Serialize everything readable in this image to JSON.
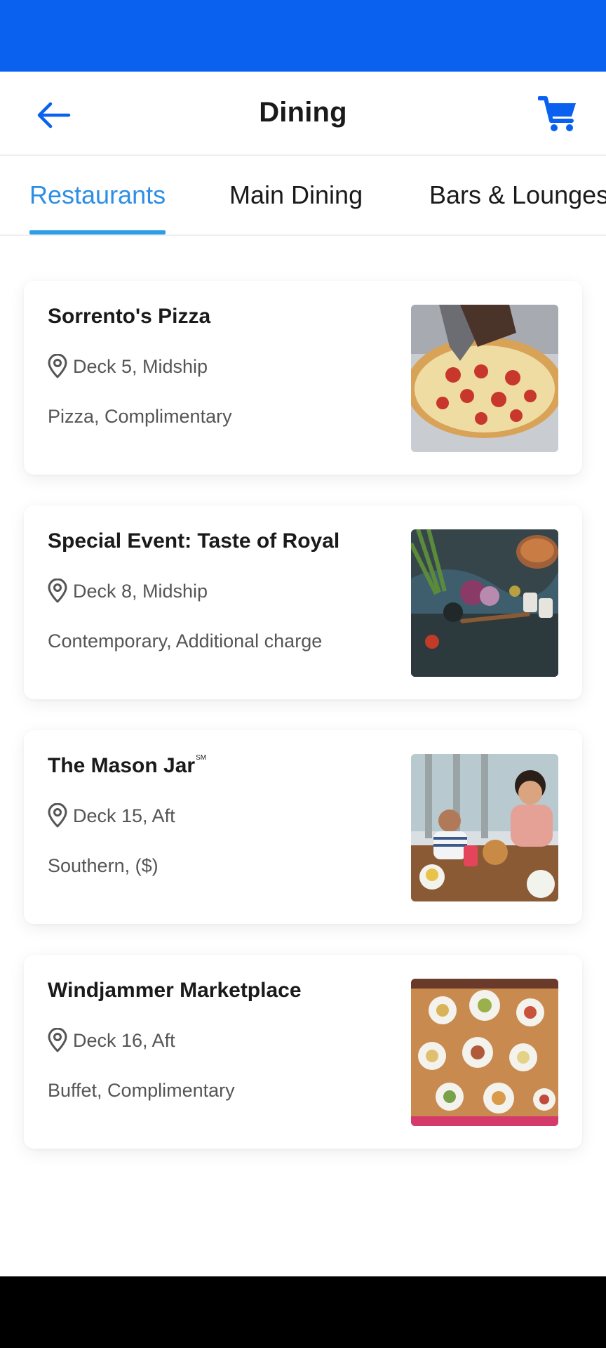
{
  "colors": {
    "brand_blue": "#0a61f0",
    "active_tab": "#2e8ee5",
    "text_primary": "#1a1a1a",
    "text_secondary": "#555555"
  },
  "header": {
    "title": "Dining",
    "back_icon": "arrow-left-icon",
    "cart_icon": "shopping-cart-icon"
  },
  "tabs": [
    {
      "label": "Restaurants",
      "active": true
    },
    {
      "label": "Main Dining",
      "active": false
    },
    {
      "label": "Bars & Lounges",
      "active": false
    }
  ],
  "restaurants": [
    {
      "name": "Sorrento's Pizza",
      "name_mark": "",
      "location": "Deck 5, Midship",
      "tags": "Pizza, Complimentary",
      "photo_icon": "pizza-photo"
    },
    {
      "name": "Special Event: Taste of Royal",
      "name_mark": "",
      "location": "Deck 8, Midship",
      "tags": "Contemporary, Additional charge",
      "photo_icon": "ingredients-photo"
    },
    {
      "name": "The Mason Jar",
      "name_mark": "SM",
      "location": "Deck 15, Aft",
      "tags": "Southern, ($)",
      "photo_icon": "family-dining-photo"
    },
    {
      "name": "Windjammer Marketplace",
      "name_mark": "",
      "location": "Deck 16, Aft",
      "tags": "Buffet, Complimentary",
      "photo_icon": "buffet-table-photo"
    }
  ]
}
